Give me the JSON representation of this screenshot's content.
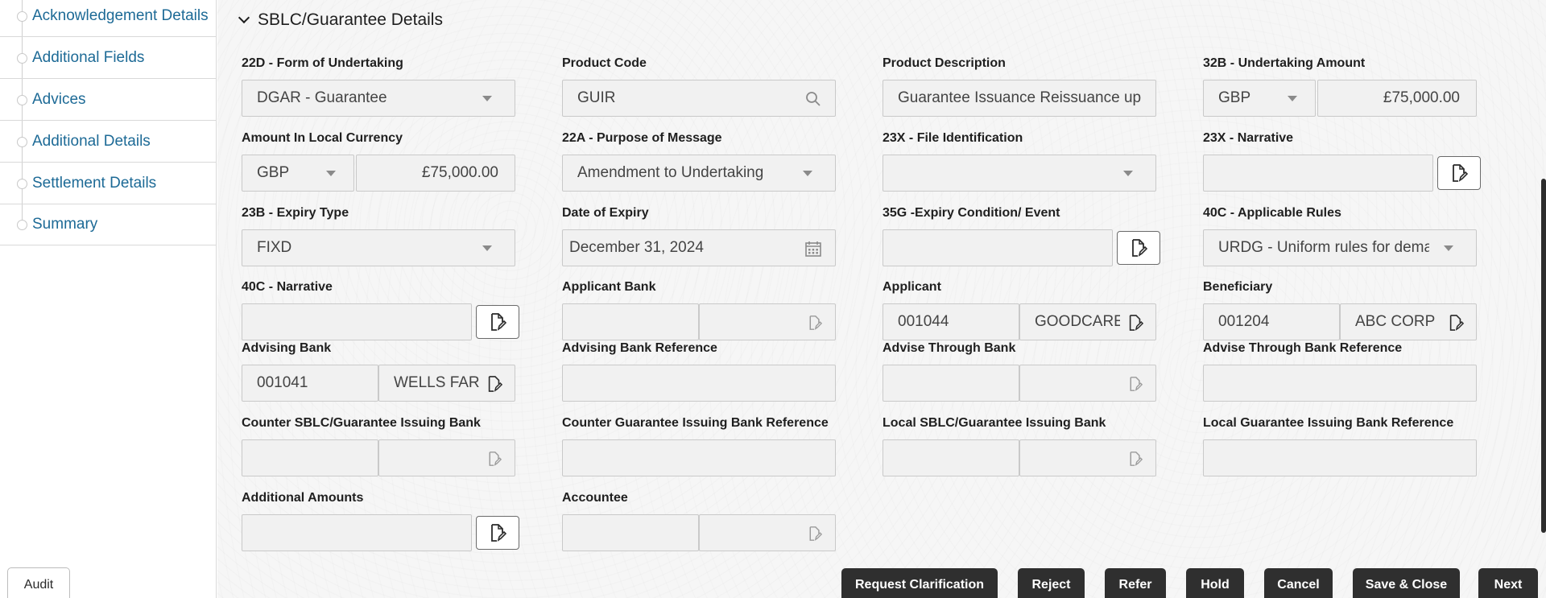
{
  "sidebar": {
    "items": [
      {
        "label": "Acknowledgement Details"
      },
      {
        "label": "Additional Fields"
      },
      {
        "label": "Advices"
      },
      {
        "label": "Additional Details"
      },
      {
        "label": "Settlement Details"
      },
      {
        "label": "Summary"
      }
    ],
    "audit_label": "Audit"
  },
  "section": {
    "title": "SBLC/Guarantee Details"
  },
  "fields": {
    "form_of_undertaking": {
      "label": "22D - Form of Undertaking",
      "value": "DGAR - Guarantee"
    },
    "product_code": {
      "label": "Product Code",
      "value": "GUIR"
    },
    "product_description": {
      "label": "Product Description",
      "value": "Guarantee Issuance  Reissuance up"
    },
    "undertaking_amount": {
      "label": "32B - Undertaking Amount",
      "currency": "GBP",
      "value": "£75,000.00"
    },
    "amount_local": {
      "label": "Amount In Local Currency",
      "currency": "GBP",
      "value": "£75,000.00"
    },
    "purpose_of_message": {
      "label": "22A - Purpose of Message",
      "value": "Amendment to Undertaking"
    },
    "file_identification": {
      "label": "23X - File Identification",
      "value": ""
    },
    "narrative_23x": {
      "label": "23X - Narrative",
      "value": ""
    },
    "expiry_type": {
      "label": "23B - Expiry Type",
      "value": "FIXD"
    },
    "date_of_expiry": {
      "label": "Date of Expiry",
      "value": "December 31, 2024"
    },
    "expiry_condition": {
      "label": "35G -Expiry Condition/ Event",
      "value": ""
    },
    "applicable_rules": {
      "label": "40C - Applicable Rules",
      "value": "URDG - Uniform rules for dema"
    },
    "narrative_40c": {
      "label": "40C - Narrative",
      "value": ""
    },
    "applicant_bank": {
      "label": "Applicant Bank",
      "id": "",
      "name": ""
    },
    "applicant": {
      "label": "Applicant",
      "id": "001044",
      "name": "GOODCARE"
    },
    "beneficiary": {
      "label": "Beneficiary",
      "id": "001204",
      "name": "ABC CORP"
    },
    "advising_bank": {
      "label": "Advising Bank",
      "id": "001041",
      "name": "WELLS FAR"
    },
    "advising_bank_ref": {
      "label": "Advising Bank Reference",
      "value": ""
    },
    "advise_through_bank": {
      "label": "Advise Through Bank",
      "id": "",
      "name": ""
    },
    "advise_through_bank_ref": {
      "label": "Advise Through Bank Reference",
      "value": ""
    },
    "counter_issuing_bank": {
      "label": "Counter SBLC/Guarantee Issuing Bank",
      "id": "",
      "name": ""
    },
    "counter_issuing_bank_ref": {
      "label": "Counter Guarantee Issuing Bank Reference",
      "value": ""
    },
    "local_issuing_bank": {
      "label": "Local SBLC/Guarantee Issuing Bank",
      "id": "",
      "name": ""
    },
    "local_issuing_bank_ref": {
      "label": "Local Guarantee Issuing Bank Reference",
      "value": ""
    },
    "additional_amounts": {
      "label": "Additional Amounts",
      "value": ""
    },
    "accountee": {
      "label": "Accountee",
      "id": "",
      "name": ""
    }
  },
  "footer": {
    "request_clarification": "Request Clarification",
    "reject": "Reject",
    "refer": "Refer",
    "hold": "Hold",
    "cancel": "Cancel",
    "save_close": "Save & Close",
    "next": "Next"
  },
  "icons": {
    "search": "search-icon",
    "calendar": "calendar-icon",
    "edit_document": "edit-document-icon",
    "dropdown": "chevron-down-icon"
  },
  "colors": {
    "link": "#1d6a96",
    "button_dark": "#2f2f2f",
    "field_bg": "#f1f1f1"
  }
}
